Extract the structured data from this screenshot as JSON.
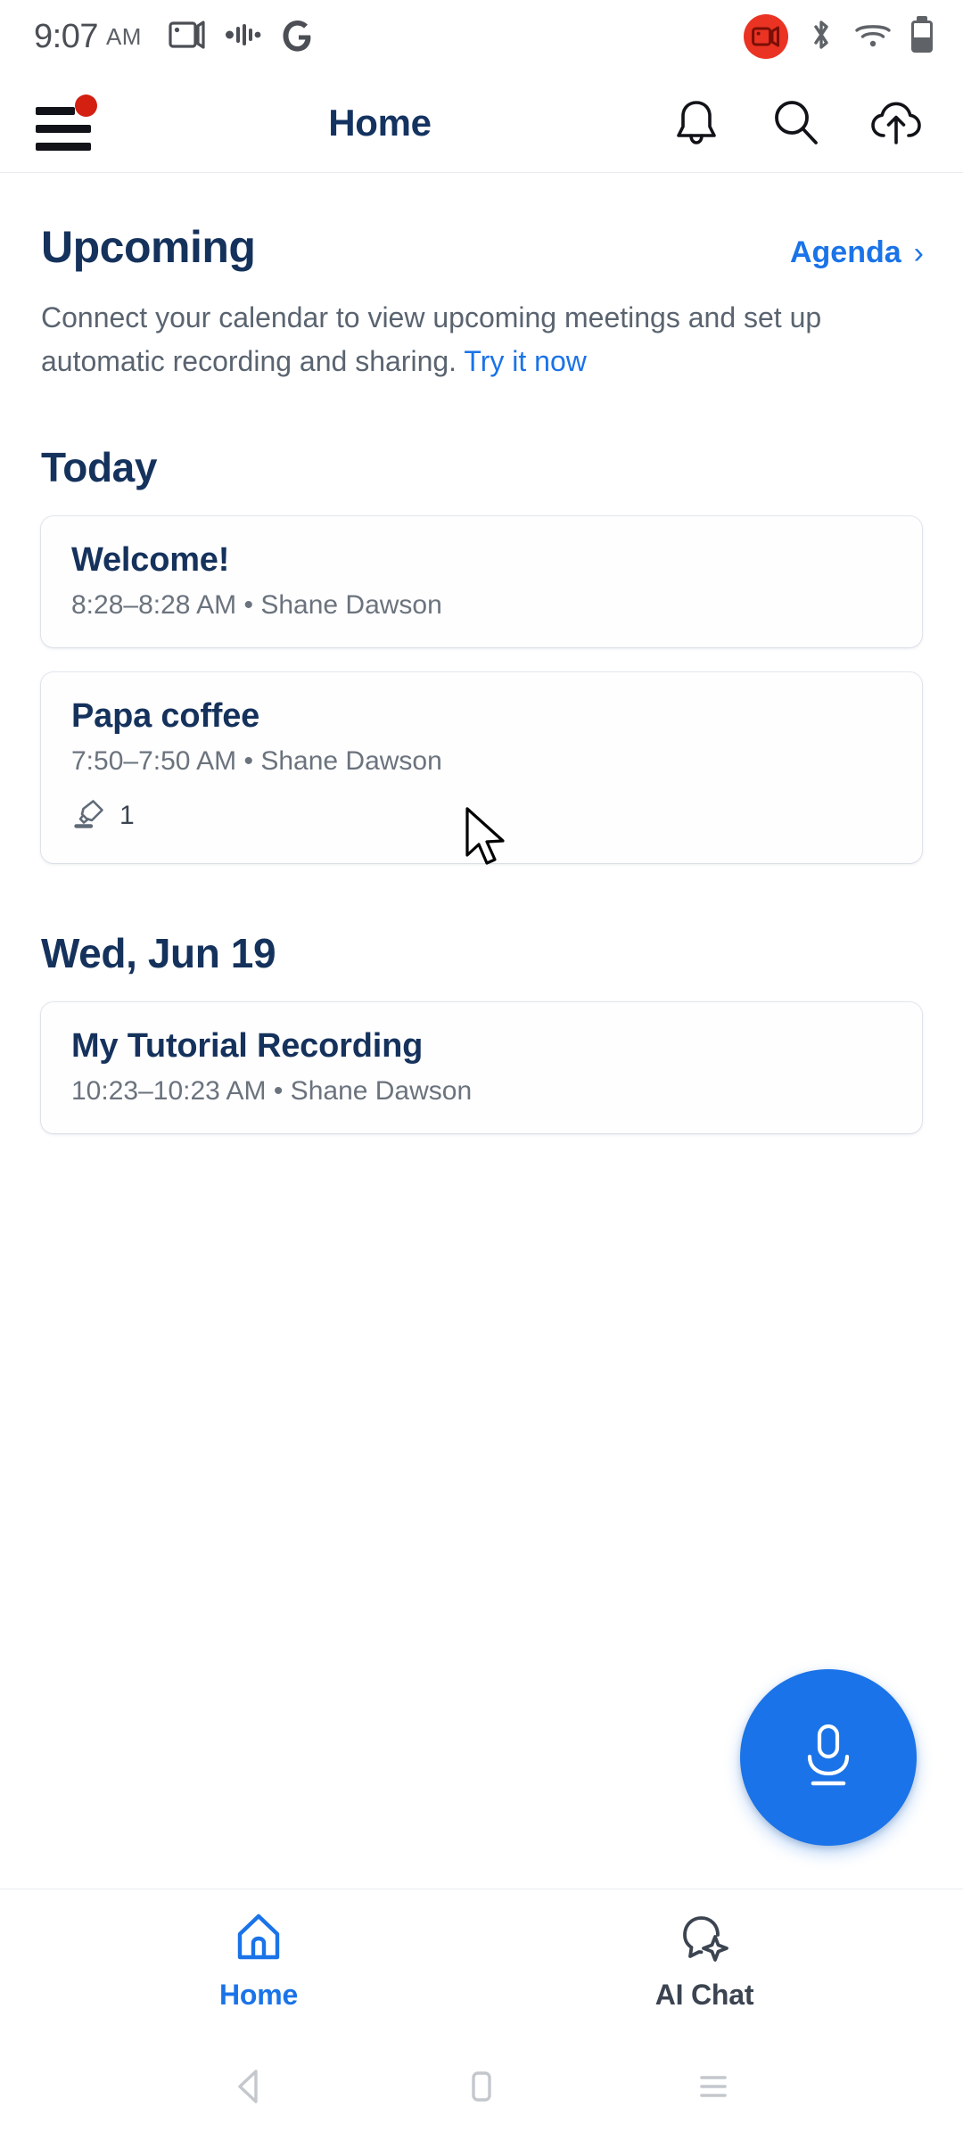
{
  "status_bar": {
    "time": "9:07",
    "ampm": "AM",
    "left_icons": [
      "screen-cast-icon",
      "audio-waveform-icon",
      "google-g-icon"
    ],
    "right_icons": [
      "screen-record-badge-icon",
      "bluetooth-icon",
      "wifi-icon",
      "battery-icon"
    ],
    "record_badge_color": "#ea3323"
  },
  "app_bar": {
    "menu_icon": "hamburger-menu-icon",
    "menu_badge": true,
    "menu_badge_color": "#d32011",
    "title": "Home",
    "actions": [
      {
        "name": "notifications-bell-icon",
        "label": "Notifications"
      },
      {
        "name": "search-icon",
        "label": "Search"
      },
      {
        "name": "cloud-upload-icon",
        "label": "Upload"
      }
    ]
  },
  "upcoming": {
    "title": "Upcoming",
    "agenda_label": "Agenda",
    "agenda_chevron": "›",
    "blurb_before": "Connect your calendar to view upcoming meetings and set up automatic recording and sharing. ",
    "blurb_link": "Try it now"
  },
  "groups": [
    {
      "day_label": "Today",
      "items": [
        {
          "title": "Welcome!",
          "subtitle": "8:28–8:28 AM  •  Shane Dawson",
          "meta_icon": "highlighter-icon",
          "meta_count": null
        },
        {
          "title": "Papa coffee",
          "subtitle": "7:50–7:50 AM  •  Shane Dawson",
          "meta_icon": "highlighter-icon",
          "meta_count": "1"
        }
      ]
    },
    {
      "day_label": "Wed, Jun 19",
      "items": [
        {
          "title": "My Tutorial Recording",
          "subtitle": "10:23–10:23 AM  •  Shane Dawson",
          "meta_icon": "highlighter-icon",
          "meta_count": null
        }
      ]
    }
  ],
  "fab": {
    "icon": "microphone-icon",
    "color": "#1a73e8"
  },
  "bottom_nav": {
    "active_color": "#1a73e8",
    "inactive_color": "#3b4450",
    "items": [
      {
        "label": "Home",
        "icon": "home-icon",
        "active": true
      },
      {
        "label": "AI Chat",
        "icon": "ai-chat-bubble-icon",
        "active": false
      }
    ]
  },
  "system_nav": {
    "back": "back-triangle-icon",
    "home": "home-square-icon",
    "recents": "recents-lines-icon"
  }
}
